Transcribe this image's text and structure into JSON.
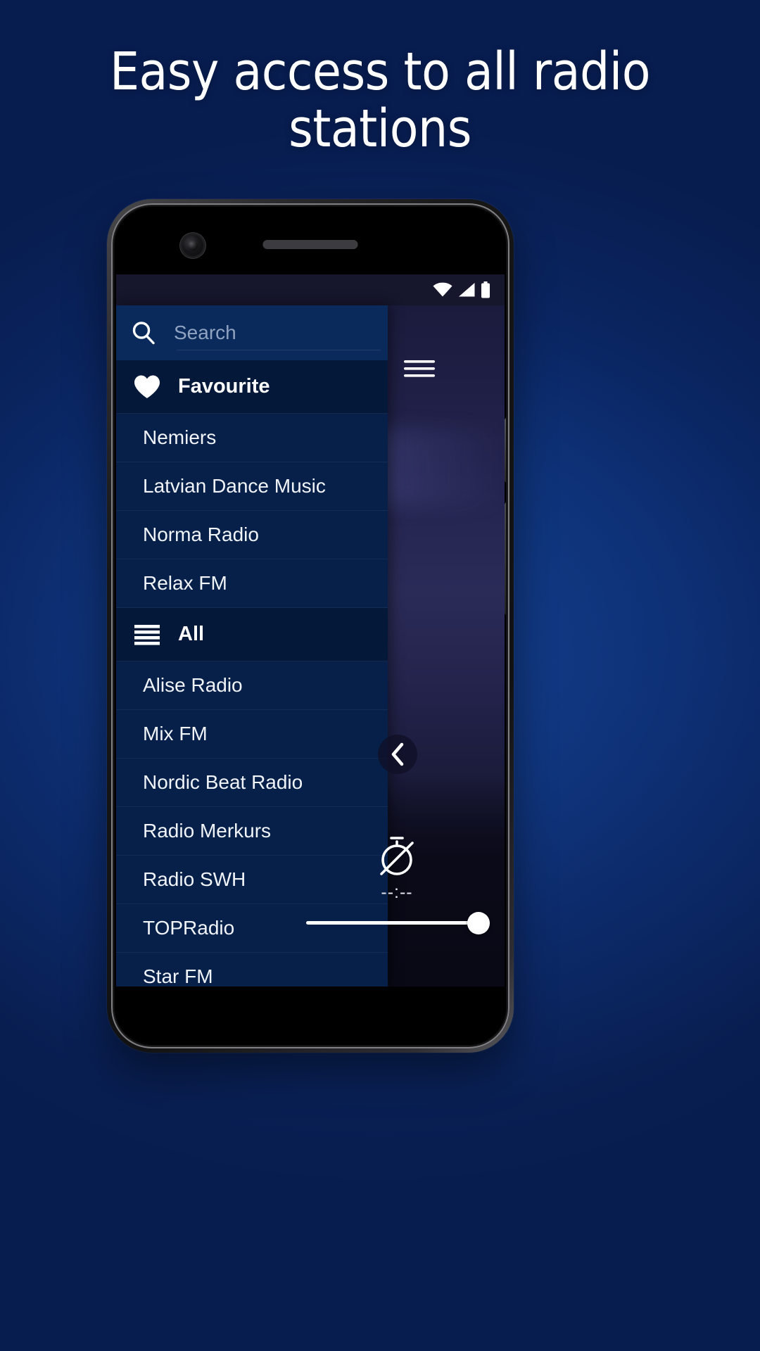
{
  "page": {
    "headline": "Easy access to all radio stations",
    "background_color": "#0b2a6b"
  },
  "phone": {
    "hardware": {
      "front_camera": "front-camera",
      "earpiece_speaker": "earpiece-speaker",
      "power_button": "power-button",
      "volume_button": "volume-rocker"
    }
  },
  "status_bar": {
    "wifi": "wifi-icon",
    "signal": "cellular-signal-icon",
    "battery": "battery-icon"
  },
  "drawer": {
    "search": {
      "icon": "search-icon",
      "value": "",
      "placeholder": "Search"
    },
    "menu_icon": "hamburger-menu-icon",
    "sections": [
      {
        "id": "favourite",
        "icon": "heart-icon",
        "label": "Favourite",
        "items": [
          {
            "label": "Nemiers"
          },
          {
            "label": "Latvian Dance Music"
          },
          {
            "label": "Norma Radio"
          },
          {
            "label": "Relax FM"
          }
        ]
      },
      {
        "id": "all",
        "icon": "list-lines-icon",
        "label": "All",
        "items": [
          {
            "label": "Alise Radio"
          },
          {
            "label": "Mix FM"
          },
          {
            "label": "Nordic Beat Radio"
          },
          {
            "label": "Radio Merkurs"
          },
          {
            "label": "Radio SWH"
          },
          {
            "label": "TOPRadio"
          },
          {
            "label": "Star FM"
          }
        ]
      }
    ]
  },
  "player": {
    "collapse_icon": "chevron-left-icon",
    "sleep_timer": {
      "icon": "timer-off-icon",
      "value": "--:--"
    },
    "volume": {
      "level_percent": 100
    }
  },
  "colors": {
    "drawer_bg": "#062049",
    "section_header_bg": "#04183a",
    "search_bg": "#0a2a5c",
    "accent_text": "#ffffff",
    "placeholder": "#8fa2c0"
  }
}
